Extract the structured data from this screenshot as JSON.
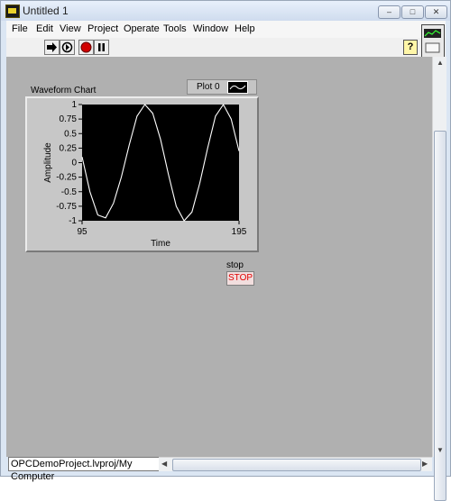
{
  "window": {
    "title": "Untitled 1"
  },
  "window_buttons": {
    "minimize": "–",
    "maximize": "□",
    "close": "✕"
  },
  "menu": [
    "File",
    "Edit",
    "View",
    "Project",
    "Operate",
    "Tools",
    "Window",
    "Help"
  ],
  "toolbar": {
    "help_glyph": "?"
  },
  "status": {
    "project_path": "OPCDemoProject.lvproj/My Computer"
  },
  "chart": {
    "label": "Waveform Chart",
    "legend_plot": "Plot 0",
    "xlabel": "Time",
    "ylabel": "Amplitude"
  },
  "stop_control": {
    "label": "stop",
    "button_text": "STOP"
  },
  "colors": {
    "panel_bg": "#b0b0b0",
    "plot_bg": "#000000",
    "trace": "#ffffff",
    "stop_text": "#e00000"
  },
  "chart_data": {
    "type": "line",
    "xlim": [
      95,
      195
    ],
    "ylim": [
      -1,
      1
    ],
    "x_ticks": [
      "95",
      "195"
    ],
    "y_ticks": [
      "1",
      "0.75",
      "0.5",
      "0.25",
      "0",
      "-0.25",
      "-0.5",
      "-0.75",
      "-1"
    ],
    "xlabel": "Time",
    "ylabel": "Amplitude",
    "series": [
      {
        "name": "Plot 0",
        "x": [
          95,
          100,
          105,
          110,
          115,
          120,
          125,
          130,
          135,
          140,
          145,
          150,
          155,
          160,
          165,
          170,
          175,
          180,
          185,
          190,
          195
        ],
        "y": [
          0.1,
          -0.5,
          -0.9,
          -0.95,
          -0.7,
          -0.25,
          0.3,
          0.8,
          1.0,
          0.85,
          0.4,
          -0.2,
          -0.75,
          -1.0,
          -0.85,
          -0.35,
          0.25,
          0.8,
          1.0,
          0.75,
          0.2
        ]
      }
    ]
  }
}
